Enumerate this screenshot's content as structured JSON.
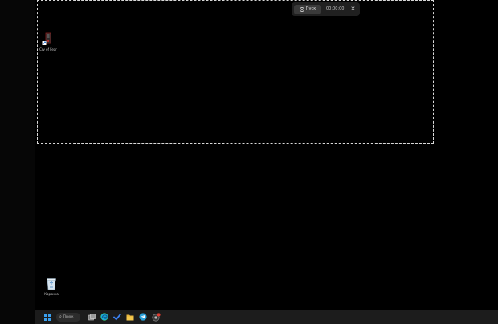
{
  "capture_toolbar": {
    "start_label": "Пуск",
    "timer": "00:00:00",
    "close_glyph": "✕"
  },
  "desktop": {
    "icons": [
      {
        "label": "Cry of Fear",
        "icon": "game-shortcut-icon"
      },
      {
        "label": "Корзина",
        "icon": "recycle-bin-icon"
      }
    ]
  },
  "taskbar": {
    "search_placeholder": "Поиск",
    "items": [
      "windows-start-icon",
      "search-icon",
      "task-view-icon",
      "edge-browser-icon",
      "todo-check-icon",
      "file-explorer-icon",
      "telegram-icon",
      "app-with-badge-icon"
    ]
  },
  "colors": {
    "background": "#000000",
    "taskbar": "#1c1c1c",
    "selection_border": "#d8d8d8",
    "toolbar": "#202020",
    "edge": "#1ba8e0",
    "todo": "#3b82f6",
    "explorer": "#e8b53a",
    "telegram": "#2aa1da",
    "badge": "#e03c31"
  }
}
